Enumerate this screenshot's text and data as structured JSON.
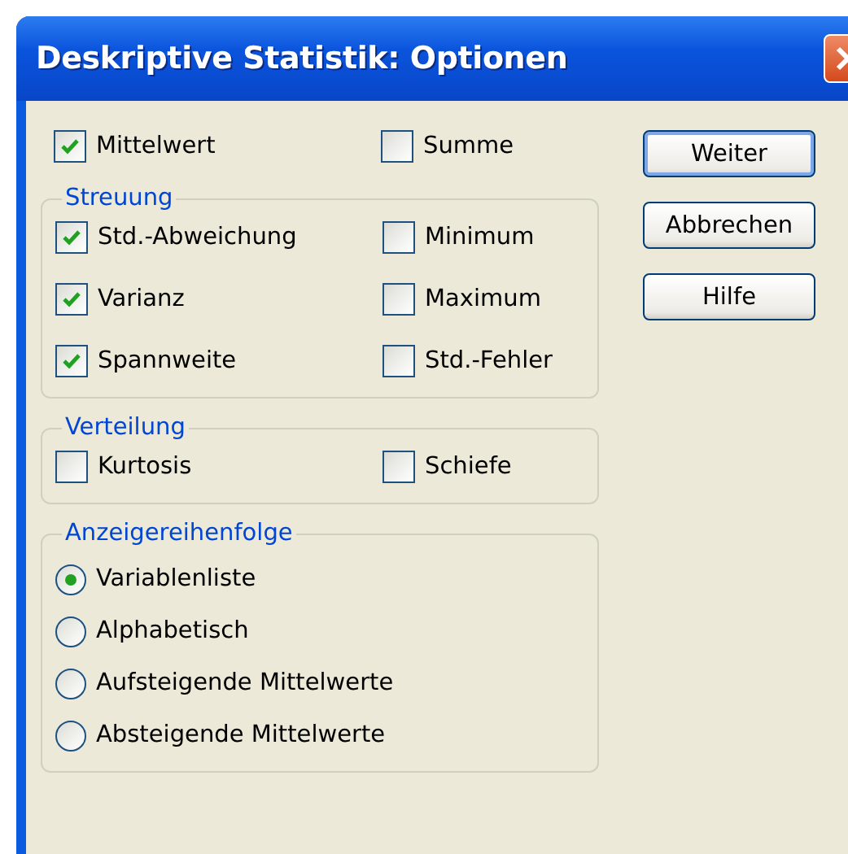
{
  "window": {
    "title": "Deskriptive Statistik: Optionen"
  },
  "top_options": [
    {
      "label": "Mittelwert",
      "checked": true
    },
    {
      "label": "Summe",
      "checked": false
    }
  ],
  "groups": [
    {
      "title": "Streuung",
      "kind": "checkboxes",
      "items": [
        {
          "label": "Std.-Abweichung",
          "checked": true
        },
        {
          "label": "Minimum",
          "checked": false
        },
        {
          "label": "Varianz",
          "checked": true
        },
        {
          "label": "Maximum",
          "checked": false
        },
        {
          "label": "Spannweite",
          "checked": true
        },
        {
          "label": "Std.-Fehler",
          "checked": false
        }
      ]
    },
    {
      "title": "Verteilung",
      "kind": "checkboxes",
      "items": [
        {
          "label": "Kurtosis",
          "checked": false
        },
        {
          "label": "Schiefe",
          "checked": false
        }
      ]
    },
    {
      "title": "Anzeigereihenfolge",
      "kind": "radios",
      "items": [
        {
          "label": "Variablenliste",
          "selected": true
        },
        {
          "label": "Alphabetisch",
          "selected": false
        },
        {
          "label": "Aufsteigende Mittelwerte",
          "selected": false
        },
        {
          "label": "Absteigende Mittelwerte",
          "selected": false
        }
      ]
    }
  ],
  "buttons": [
    {
      "label": "Weiter",
      "default": true
    },
    {
      "label": "Abbrechen",
      "default": false
    },
    {
      "label": "Hilfe",
      "default": false
    }
  ]
}
